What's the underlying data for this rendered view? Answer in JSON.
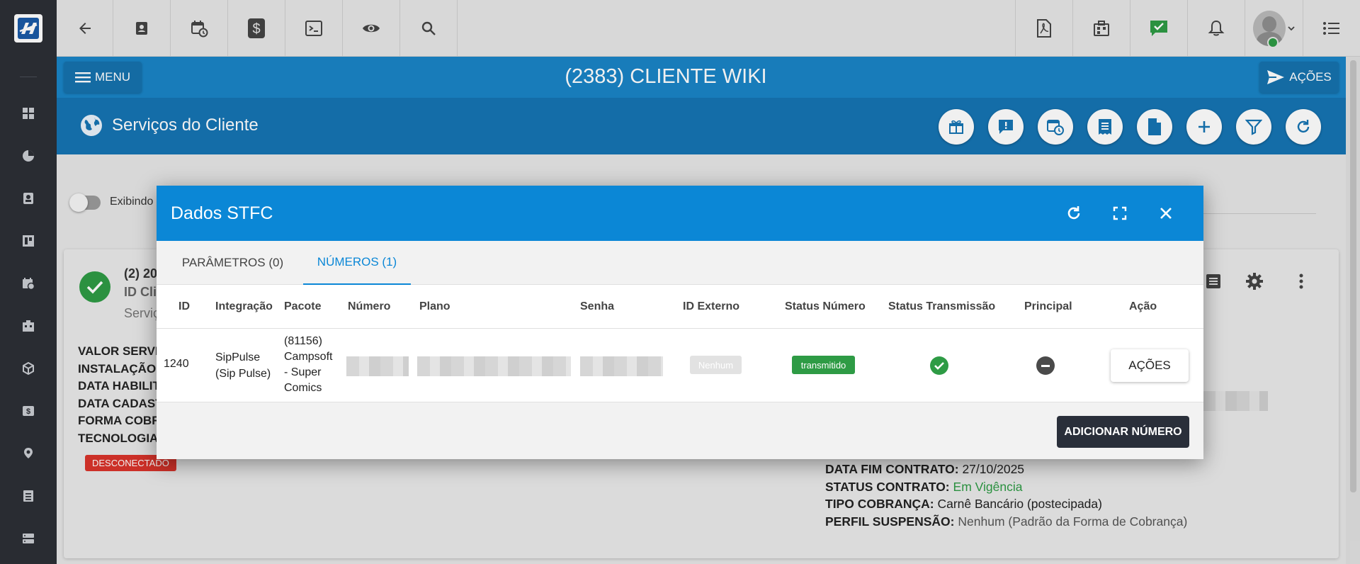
{
  "header": {
    "title": "(2383) CLIENTE WIKI",
    "menu_label": "MENU",
    "acoes_label": "AÇÕES"
  },
  "section": {
    "title": "Serviços do Cliente"
  },
  "background": {
    "toggle_label": "Exibindo",
    "card_title": "(2) 20",
    "card_subtitle": "ID Cli",
    "card_line3": "Serviç",
    "left_info": [
      "VALOR SERVIÇ",
      "INSTALAÇÃO:",
      "DATA HABILIT",
      "DATA CADAST",
      "FORMA COBRA",
      "TECNOLOGIA"
    ],
    "status_badge": "DESCONECTADO",
    "right_info": [
      {
        "label": "DATA FIM CONTRATO:",
        "value": "27/10/2025"
      },
      {
        "label": "STATUS CONTRATO:",
        "value": "Em Vigência"
      },
      {
        "label": "TIPO COBRANÇA:",
        "value": "Carnê Bancário (postecipada)"
      },
      {
        "label": "PERFIL SUSPENSÃO:",
        "value": "Nenhum (Padrão da Forma de Cobrança)"
      }
    ]
  },
  "modal": {
    "title": "Dados STFC",
    "tabs": [
      "PARÂMETROS (0)",
      "NÚMEROS (1)"
    ],
    "active_tab": "NÚMEROS (1)",
    "columns": [
      "ID",
      "Integração",
      "Pacote",
      "Número",
      "Plano",
      "Senha",
      "ID Externo",
      "Status Número",
      "Status Transmissão",
      "Principal",
      "Ação"
    ],
    "rows": [
      {
        "id": "1240",
        "integracao": "SipPulse (Sip Pulse)",
        "pacote": "(81156) Campsoft - Super Comics",
        "id_externo": "Nenhum",
        "status_numero": "transmitido",
        "acao": "AÇÕES"
      }
    ],
    "add_button": "ADICIONAR NÚMERO"
  },
  "colors": {
    "brand_blue": "#1a84c6",
    "modal_header": "#0b87d6",
    "success": "#2e9b45",
    "danger": "#d9342b",
    "sidebar": "#2c2f36"
  }
}
